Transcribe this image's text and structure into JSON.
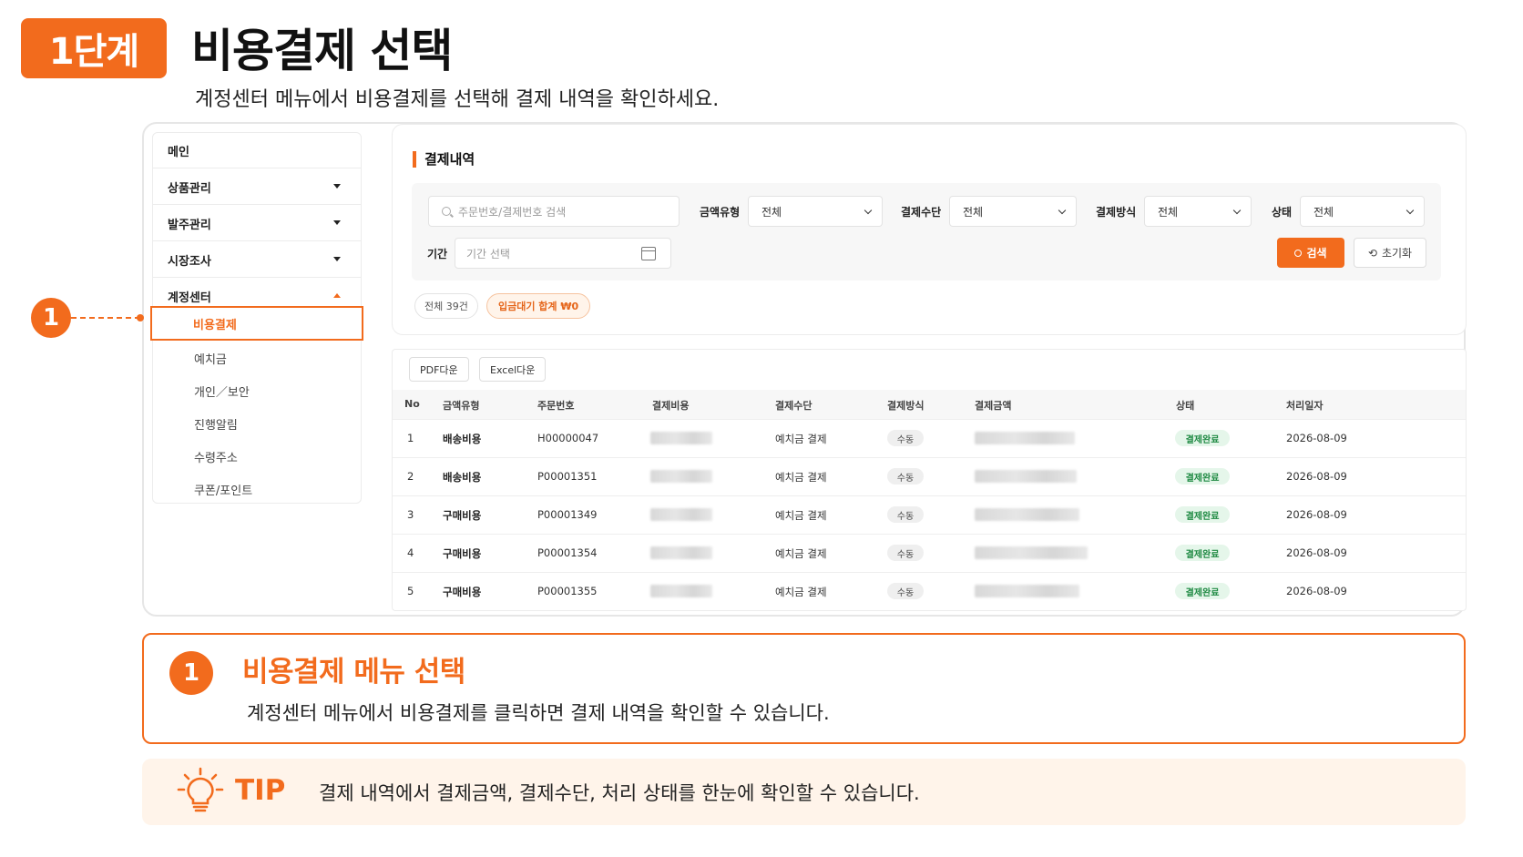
{
  "header": {
    "step_badge": "1단계",
    "title": "비용결제 선택",
    "subtitle": "계정센터 메뉴에서 비용결제를 선택해 결제 내역을 확인하세요."
  },
  "marker_number": "1",
  "sidebar": {
    "items": [
      {
        "label": "메인"
      },
      {
        "label": "상품관리"
      },
      {
        "label": "발주관리"
      },
      {
        "label": "시장조사"
      },
      {
        "label": "계정센터"
      }
    ],
    "active_sub": "비용결제",
    "sub_items": [
      "예치금",
      "개인／보안",
      "진행알림",
      "수령주소",
      "쿠폰/포인트"
    ]
  },
  "section_title": "결제내역",
  "filters": {
    "search_placeholder": "주문번호/결제번호 검색",
    "amount_type_label": "금액유형",
    "amount_type_value": "전체",
    "pay_means_label": "결제수단",
    "pay_means_value": "전체",
    "pay_method_label": "결제방식",
    "pay_method_value": "전체",
    "status_label": "상태",
    "status_value": "전체",
    "period_label": "기간",
    "period_placeholder": "기간 선택",
    "search_button": "검색",
    "reset_button": "초기화"
  },
  "summary": {
    "total": "전체 39건",
    "pending": "입금대기 합계 ₩0"
  },
  "downloads": {
    "pdf": "PDF다운",
    "excel": "Excel다운"
  },
  "table": {
    "headers": [
      "No",
      "금액유형",
      "주문번호",
      "결제비용",
      "결제수단",
      "결제방식",
      "결제금액",
      "상태",
      "처리일자"
    ],
    "rows": [
      {
        "no": "1",
        "type": "배송비용",
        "order": "H00000047",
        "means": "예치금 결제",
        "method": "수동",
        "status": "결제완료",
        "date": "2026-08-09"
      },
      {
        "no": "2",
        "type": "배송비용",
        "order": "P00001351",
        "means": "예치금 결제",
        "method": "수동",
        "status": "결제완료",
        "date": "2026-08-09"
      },
      {
        "no": "3",
        "type": "구매비용",
        "order": "P00001349",
        "means": "예치금 결제",
        "method": "수동",
        "status": "결제완료",
        "date": "2026-08-09"
      },
      {
        "no": "4",
        "type": "구매비용",
        "order": "P00001354",
        "means": "예치금 결제",
        "method": "수동",
        "status": "결제완료",
        "date": "2026-08-09"
      },
      {
        "no": "5",
        "type": "구매비용",
        "order": "P00001355",
        "means": "예치금 결제",
        "method": "수동",
        "status": "결제완료",
        "date": "2026-08-09"
      }
    ]
  },
  "callout": {
    "number": "1",
    "title": "비용결제 메뉴 선택",
    "description": "계정센터 메뉴에서 비용결제를 클릭하면 결제 내역을 확인할 수 있습니다."
  },
  "tip": {
    "icon": "lightbulb-icon",
    "label": "TIP",
    "text": "결제 내역에서 결제금액, 결제수단, 처리 상태를 한눈에 확인할 수 있습니다."
  },
  "colors": {
    "accent": "#f26b1d",
    "tip_background": "#fff4ea",
    "status_green": "#1f8a43"
  }
}
